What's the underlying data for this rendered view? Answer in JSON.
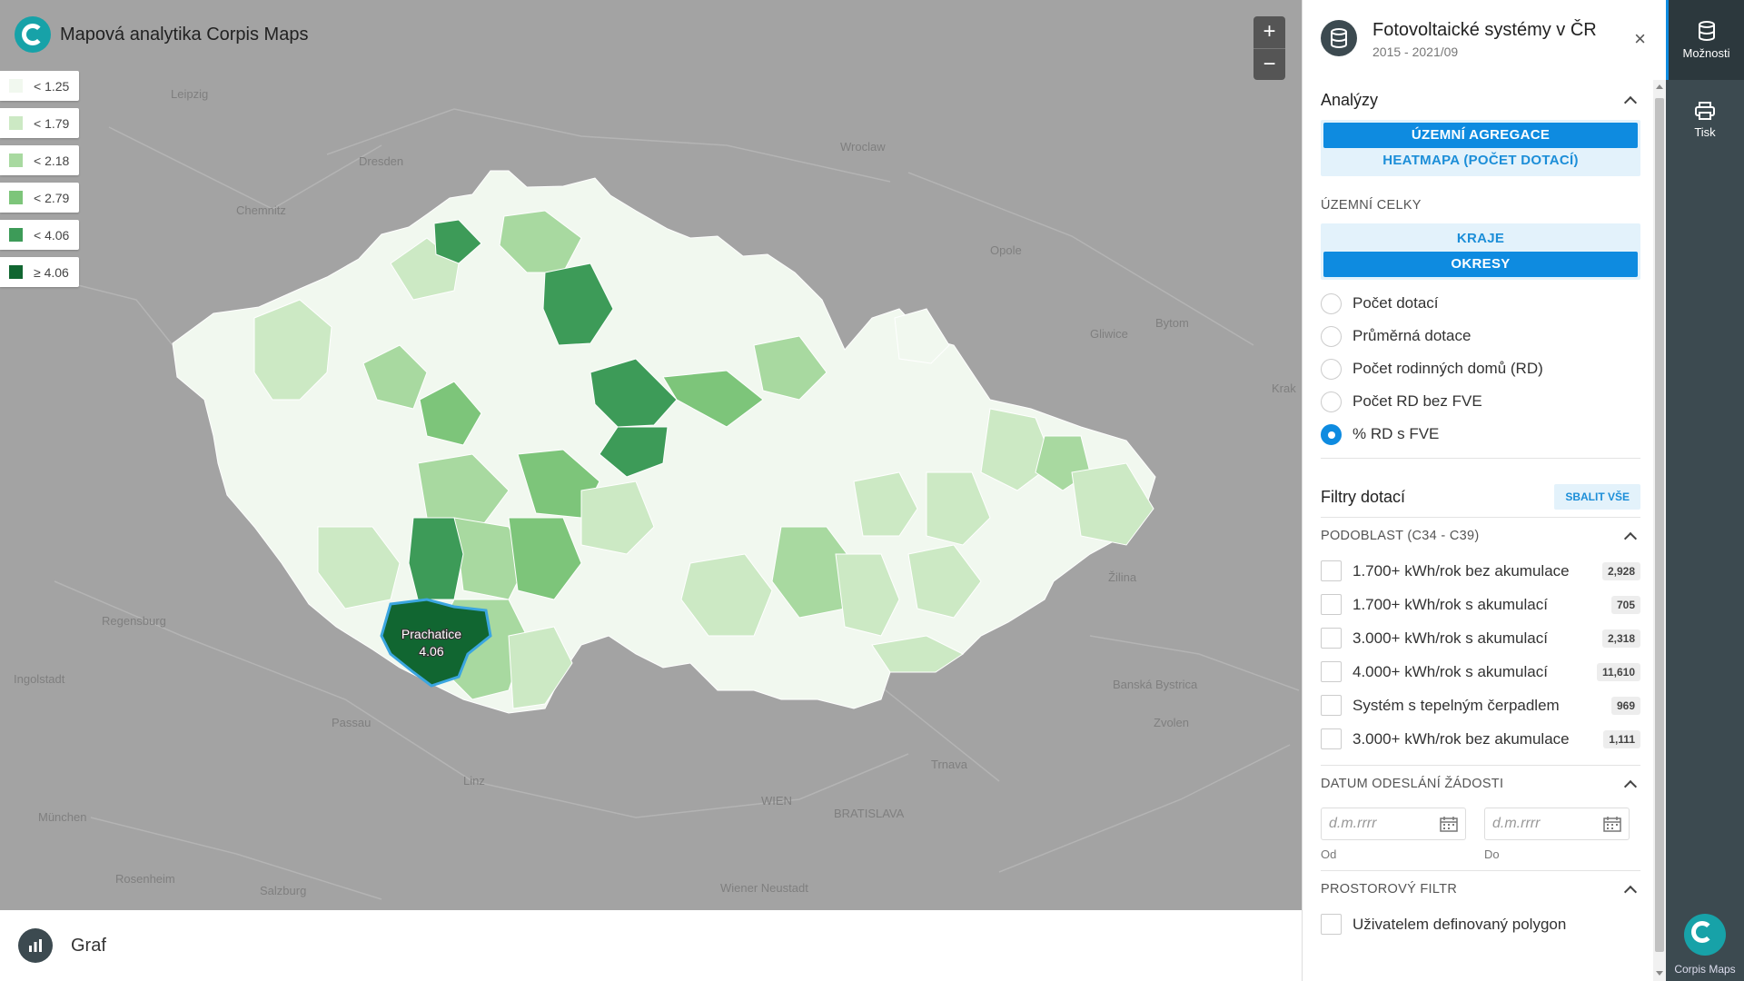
{
  "app": {
    "title": "Mapová analytika Corpis Maps",
    "logo": "corpis-c-logo"
  },
  "legend": [
    {
      "label": "< 1.25",
      "color": "#f1f8ef"
    },
    {
      "label": "< 1.79",
      "color": "#cce9c4"
    },
    {
      "label": "< 2.18",
      "color": "#a8d9a0"
    },
    {
      "label": "< 2.79",
      "color": "#7dc57a"
    },
    {
      "label": "< 4.06",
      "color": "#3d9b58"
    },
    {
      "label": "≥ 4.06",
      "color": "#116631"
    }
  ],
  "zoom": {
    "plus": "+",
    "minus": "−"
  },
  "map": {
    "cities": [
      "Leipzig",
      "Dresden",
      "Chemnitz",
      "Wroclaw",
      "Opole",
      "Bytom",
      "Gliwice",
      "Krak",
      "Regensburg",
      "Ingolstadt",
      "Passau",
      "München",
      "Rosenheim",
      "Salzburg",
      "Linz",
      "Wiener Neustadt",
      "WIEN",
      "BRATISLAVA",
      "Trnava",
      "Žilina",
      "Banská Bystrica",
      "Zvolen"
    ],
    "highlight": {
      "name": "Prachatice",
      "value": "4.06"
    }
  },
  "bottom": {
    "label": "Graf",
    "icon": "bar-chart-icon"
  },
  "panel": {
    "title": "Fotovoltaické systémy v ČR",
    "subtitle": "2015 - 2021/09",
    "close": "×",
    "analyses": {
      "heading": "Analýzy",
      "buttons": [
        "ÚZEMNÍ AGREGACE",
        "HEATMAPA (POČET DOTACÍ)"
      ]
    },
    "units": {
      "heading": "ÚZEMNÍ CELKY",
      "buttons": [
        "KRAJE",
        "OKRESY"
      ]
    },
    "radios": [
      "Počet dotací",
      "Průměrná dotace",
      "Počet rodinných domů (RD)",
      "Počet RD bez FVE",
      "% RD s FVE"
    ],
    "filters": {
      "heading": "Filtry dotací",
      "collapse_all": "SBALIT VŠE",
      "subarea": {
        "heading": "PODOBLAST (C34 - C39)",
        "items": [
          {
            "label": "1.700+ kWh/rok bez akumulace",
            "count": "2,928"
          },
          {
            "label": "1.700+ kWh/rok s akumulací",
            "count": "705"
          },
          {
            "label": "3.000+ kWh/rok s akumulací",
            "count": "2,318"
          },
          {
            "label": "4.000+ kWh/rok s akumulací",
            "count": "11,610"
          },
          {
            "label": "Systém s tepelným čerpadlem",
            "count": "969"
          },
          {
            "label": "3.000+ kWh/rok bez akumulace",
            "count": "1,111"
          }
        ]
      },
      "date": {
        "heading": "DATUM ODESLÁNÍ ŽÁDOSTI",
        "from_placeholder": "d.m.rrrr",
        "to_placeholder": "d.m.rrrr",
        "from_label": "Od",
        "to_label": "Do"
      },
      "spatial": {
        "heading": "PROSTOROVÝ FILTR",
        "item": "Uživatelem definovaný polygon"
      }
    }
  },
  "rightbar": {
    "options": "Možnosti",
    "print": "Tisk",
    "brand": "Corpis Maps"
  }
}
